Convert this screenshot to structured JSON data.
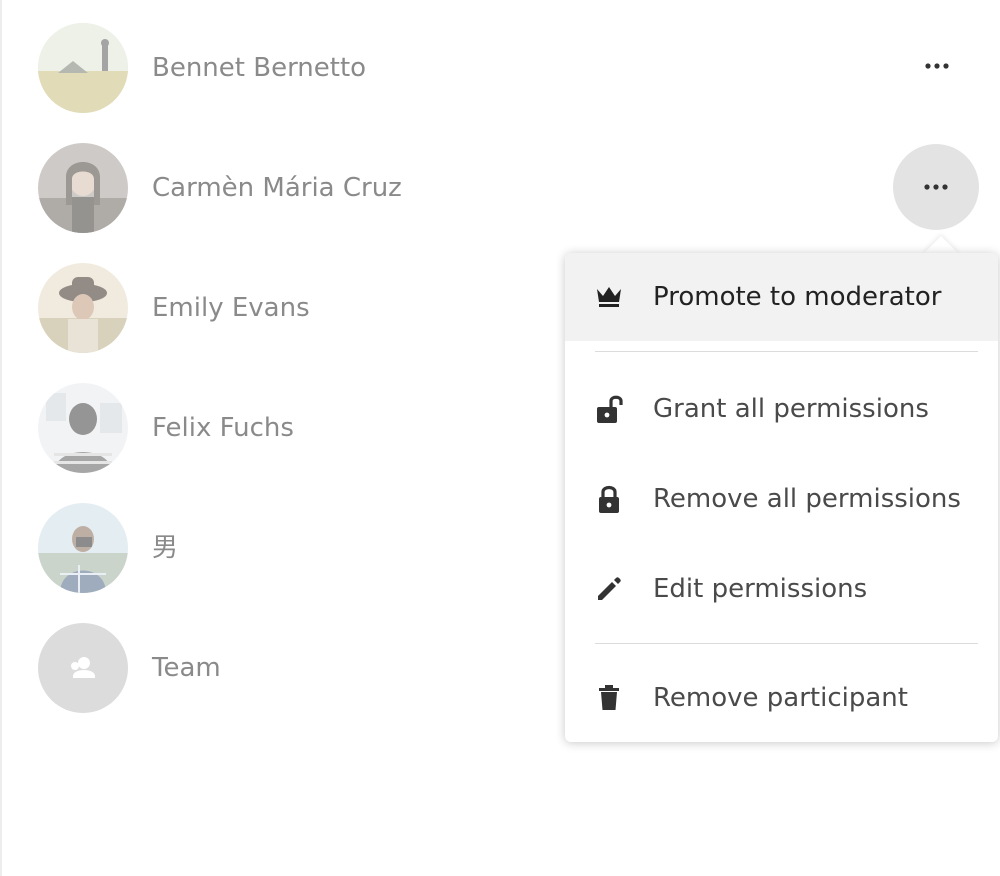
{
  "participants": [
    {
      "name": "Bennet Bernetto",
      "avatar": "landscape-photo",
      "colors": [
        "#b8c7a2",
        "#d9c68a",
        "#7a8a6a"
      ]
    },
    {
      "name": "Carmèn Mária Cruz",
      "avatar": "portrait-photo",
      "colors": [
        "#7a6f63",
        "#c9b2a3",
        "#4f4a45"
      ]
    },
    {
      "name": "Emily Evans",
      "avatar": "portrait-hat-photo",
      "colors": [
        "#c7b89d",
        "#6b5a48",
        "#e4d7c4"
      ]
    },
    {
      "name": "Felix Fuchs",
      "avatar": "portrait-back-photo",
      "colors": [
        "#9aa3a8",
        "#4a4a4a",
        "#d8dde0"
      ]
    },
    {
      "name": "男",
      "avatar": "portrait-camera-photo",
      "colors": [
        "#9fc0cf",
        "#5d6e7a",
        "#c9d5da"
      ]
    },
    {
      "name": "Team",
      "avatar": "group-icon",
      "colors": [
        "#c9c9c9",
        "#ffffff"
      ]
    }
  ],
  "more_button_label": "More actions",
  "active_participant_index": 1,
  "menu": {
    "items": [
      {
        "label": "Promote to moderator",
        "icon": "crown-icon"
      },
      {
        "label": "Grant all permissions",
        "icon": "lock-open-icon"
      },
      {
        "label": "Remove all permissions",
        "icon": "lock-icon"
      },
      {
        "label": "Edit permissions",
        "icon": "pencil-icon"
      },
      {
        "label": "Remove participant",
        "icon": "trash-icon"
      }
    ]
  },
  "colors": {
    "menu_text": "#4a4a4a",
    "muted_text": "#8a8a8a",
    "highlight_bg": "#f2f2f2",
    "active_button_bg": "#e3e3e3"
  }
}
